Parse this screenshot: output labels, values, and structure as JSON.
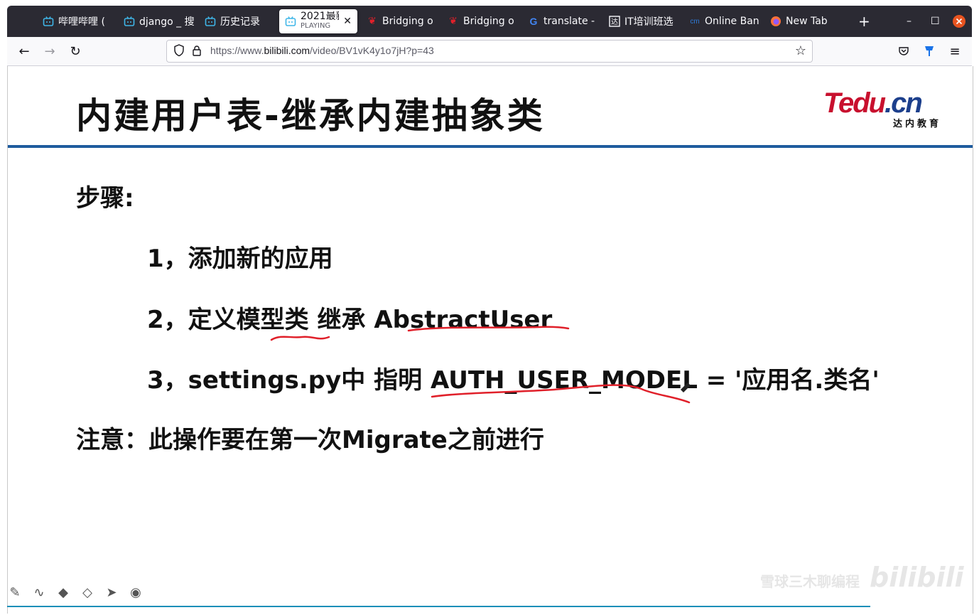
{
  "browser": {
    "tabs": [
      {
        "title": "哔哩哔哩 (",
        "icon": "bilibili-icon",
        "active": false
      },
      {
        "title": "django _ 搜",
        "icon": "bilibili-icon",
        "active": false
      },
      {
        "title": "历史记录",
        "icon": "bilibili-icon",
        "active": false
      },
      {
        "title": "2021最新",
        "subtitle": "PLAYING",
        "icon": "bilibili-icon",
        "active": true
      },
      {
        "title": "Bridging o",
        "icon": "maple-leaf-icon",
        "active": false
      },
      {
        "title": "Bridging o",
        "icon": "maple-leaf-icon",
        "active": false
      },
      {
        "title": "translate -",
        "icon": "google-icon",
        "active": false
      },
      {
        "title": "IT培训班选",
        "icon": "site-icon",
        "active": false
      },
      {
        "title": "Online Ban",
        "icon": "bank-icon",
        "active": false
      },
      {
        "title": "New Tab",
        "icon": "firefox-icon",
        "active": false
      }
    ],
    "url_prefix": "https://www.",
    "url_host": "bilibili.com",
    "url_path": "/video/BV1vK4y1o7jH?p=43"
  },
  "slide": {
    "title": "内建用户表-继承内建抽象类",
    "logo_main": "Tedu",
    "logo_dot": ".cn",
    "logo_sub": "达内教育",
    "steps_label": "步骤:",
    "step1": "1，添加新的应用",
    "step2": "2，定义模型类 继承 AbstractUser",
    "step3": "3，settings.py中 指明 AUTH_USER_MODEL = '应用名.类名'",
    "note": "注意：此操作要在第一次Migrate之前进行"
  },
  "watermark": {
    "text": "雪球三木聊编程",
    "logo": "bilibili"
  },
  "colors": {
    "tabbar_bg": "#2b2a33",
    "title_rule": "#1f5c9e",
    "annotation_red": "#e0202a",
    "logo_red": "#c8102e",
    "logo_blue": "#1c3f8c"
  }
}
